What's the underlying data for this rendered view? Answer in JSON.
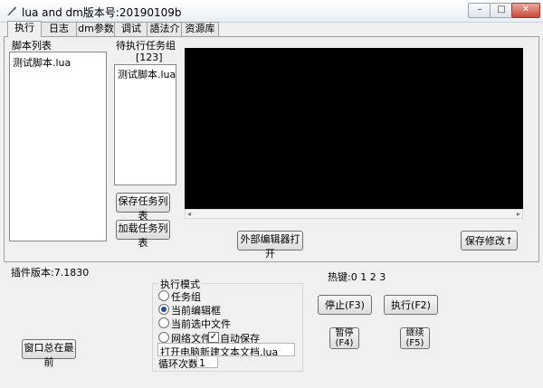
{
  "window": {
    "title": "lua and dm版本号:20190109b",
    "controls": {
      "min": "–",
      "max": "□",
      "close": "✕"
    }
  },
  "tabs": [
    "执行",
    "日志",
    "dm参数",
    "调试",
    "語法介紹",
    "资源库"
  ],
  "script_list": {
    "label": "脚本列表",
    "items": [
      "测试脚本.lua"
    ]
  },
  "task_group": {
    "label": "待执行任务组",
    "tag": "[123]",
    "items": [
      "测试脚本.lua"
    ],
    "save_button": "保存任务列表",
    "load_button": "加载任务列表"
  },
  "editor": {
    "open_external_button": "外部编辑器打开",
    "save_button": "保存修改↑"
  },
  "status": {
    "plugin_version": "插件版本:7.1830",
    "hotkeys": "热键:0 1 2 3"
  },
  "exec_mode": {
    "title": "执行模式",
    "options": [
      "任务组",
      "当前编辑框",
      "当前选中文件",
      "网络文件"
    ],
    "selected": "当前编辑框",
    "auto_save_label": "自动保存",
    "auto_save_checked": true,
    "file_field": "打开电脑新建文本文档.lua",
    "loop_label": "循环次数",
    "loop_count": "1"
  },
  "buttons": {
    "stop": "停止(F3)",
    "run": "执行(F2)",
    "pause_line1": "暂停",
    "pause_line2": "(F4)",
    "continue_line1": "继续",
    "continue_line2": "(F5)",
    "topmost": "窗口总在最前"
  }
}
